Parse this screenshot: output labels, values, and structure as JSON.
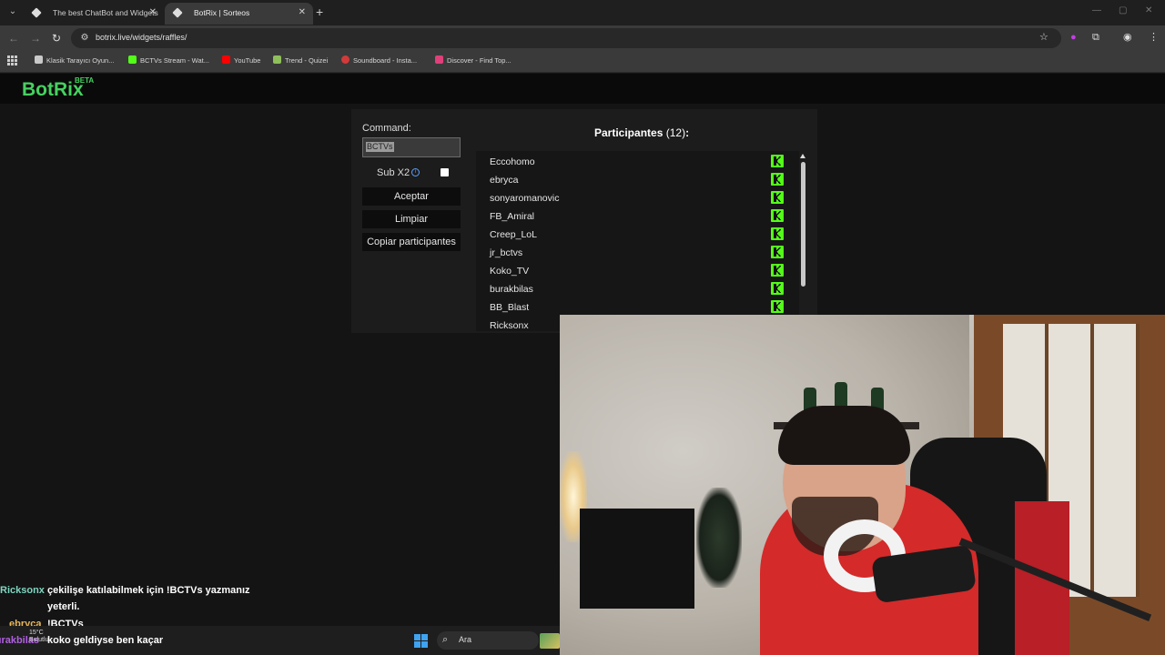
{
  "browser": {
    "tabs": [
      {
        "label": "The best ChatBot and Widgets",
        "active": false
      },
      {
        "label": "BotRix | Sorteos",
        "active": true
      }
    ],
    "url": "botrix.live/widgets/raffles/",
    "bookmarks": [
      {
        "label": "Klasik Tarayıcı Oyun...",
        "color": "#c9c9c9"
      },
      {
        "label": "BCTVs Stream - Wat...",
        "color": "#53fc18"
      },
      {
        "label": "YouTube",
        "color": "#ff0000"
      },
      {
        "label": "Trend - Quizei",
        "color": "#8fbf5a"
      },
      {
        "label": "Soundboard - Insta...",
        "color": "#d23a3a"
      },
      {
        "label": "Discover - Find Top...",
        "color": "#e0407a"
      }
    ]
  },
  "site": {
    "logo": "BotRix",
    "badge": "BETA",
    "accent": "#46d160"
  },
  "raffle": {
    "command_label": "Command:",
    "command_value": "BCTVs",
    "sub_label": "Sub X2",
    "sub_checked": false,
    "buttons": {
      "accept": "Aceptar",
      "clear": "Limpiar",
      "copy": "Copiar participantes"
    },
    "participants_title": "Participantes",
    "participants_count": "(12)",
    "participants_suffix": ":",
    "platform_color": "#53fc18",
    "participants": [
      "Eccohomo",
      "ebryca",
      "sonyaromanovic",
      "FB_Amiral",
      "Creep_LoL",
      "jr_bctvs",
      "Koko_TV",
      "burakbilas",
      "BB_Blast",
      "Ricksonx"
    ]
  },
  "chat": [
    {
      "user": "Ricksonx",
      "color": "#7fd6c0",
      "message": "çekilişe katılabilmek için !BCTVs yazmanız"
    },
    {
      "user": "",
      "color": "#ffffff",
      "message": "yeterli."
    },
    {
      "user": "ebryca",
      "color": "#e8b85a",
      "message": "!BCTVs"
    },
    {
      "user": "burakbilas",
      "color": "#b060e0",
      "message": "koko geldiyse ben kaçar"
    }
  ],
  "taskbar": {
    "weather_temp": "15°C",
    "weather_desc": "Bulutlu",
    "search_placeholder": "Ara"
  }
}
